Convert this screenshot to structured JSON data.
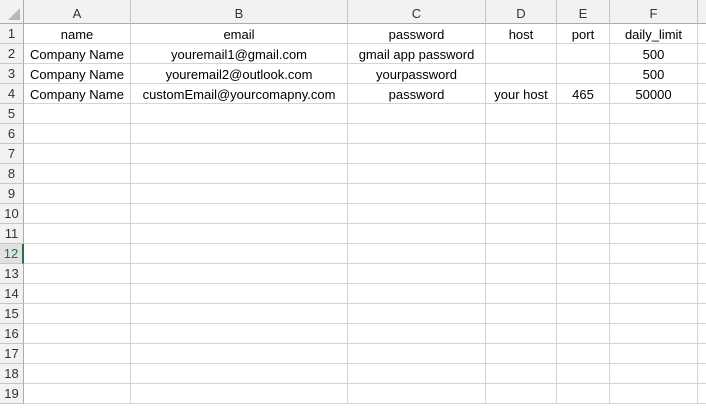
{
  "columns": [
    "A",
    "B",
    "C",
    "D",
    "E",
    "F"
  ],
  "rows": [
    {
      "num": "1",
      "cells": [
        "name",
        "email",
        "password",
        "host",
        "port",
        "daily_limit"
      ]
    },
    {
      "num": "2",
      "cells": [
        "Company Name",
        "youremail1@gmail.com",
        "gmail app password",
        "",
        "",
        "500"
      ]
    },
    {
      "num": "3",
      "cells": [
        "Company Name",
        "youremail2@outlook.com",
        "yourpassword",
        "",
        "",
        "500"
      ]
    },
    {
      "num": "4",
      "cells": [
        "Company Name",
        "customEmail@yourcomapny.com",
        "password",
        "your host",
        "465",
        "50000"
      ]
    },
    {
      "num": "5",
      "cells": [
        "",
        "",
        "",
        "",
        "",
        ""
      ]
    },
    {
      "num": "6",
      "cells": [
        "",
        "",
        "",
        "",
        "",
        ""
      ]
    },
    {
      "num": "7",
      "cells": [
        "",
        "",
        "",
        "",
        "",
        ""
      ]
    },
    {
      "num": "8",
      "cells": [
        "",
        "",
        "",
        "",
        "",
        ""
      ]
    },
    {
      "num": "9",
      "cells": [
        "",
        "",
        "",
        "",
        "",
        ""
      ]
    },
    {
      "num": "10",
      "cells": [
        "",
        "",
        "",
        "",
        "",
        ""
      ]
    },
    {
      "num": "11",
      "cells": [
        "",
        "",
        "",
        "",
        "",
        ""
      ]
    },
    {
      "num": "12",
      "cells": [
        "",
        "",
        "",
        "",
        "",
        ""
      ]
    },
    {
      "num": "13",
      "cells": [
        "",
        "",
        "",
        "",
        "",
        ""
      ]
    },
    {
      "num": "14",
      "cells": [
        "",
        "",
        "",
        "",
        "",
        ""
      ]
    },
    {
      "num": "15",
      "cells": [
        "",
        "",
        "",
        "",
        "",
        ""
      ]
    },
    {
      "num": "16",
      "cells": [
        "",
        "",
        "",
        "",
        "",
        ""
      ]
    },
    {
      "num": "17",
      "cells": [
        "",
        "",
        "",
        "",
        "",
        ""
      ]
    },
    {
      "num": "18",
      "cells": [
        "",
        "",
        "",
        "",
        "",
        ""
      ]
    },
    {
      "num": "19",
      "cells": [
        "",
        "",
        "",
        "",
        "",
        ""
      ]
    }
  ],
  "active_row": "12",
  "colors": {
    "active_row_header": "#217346",
    "gridline": "#d4d4d4",
    "header_bg": "#f2f2f2"
  },
  "icons": {
    "select_all": "select-all-triangle-icon"
  }
}
